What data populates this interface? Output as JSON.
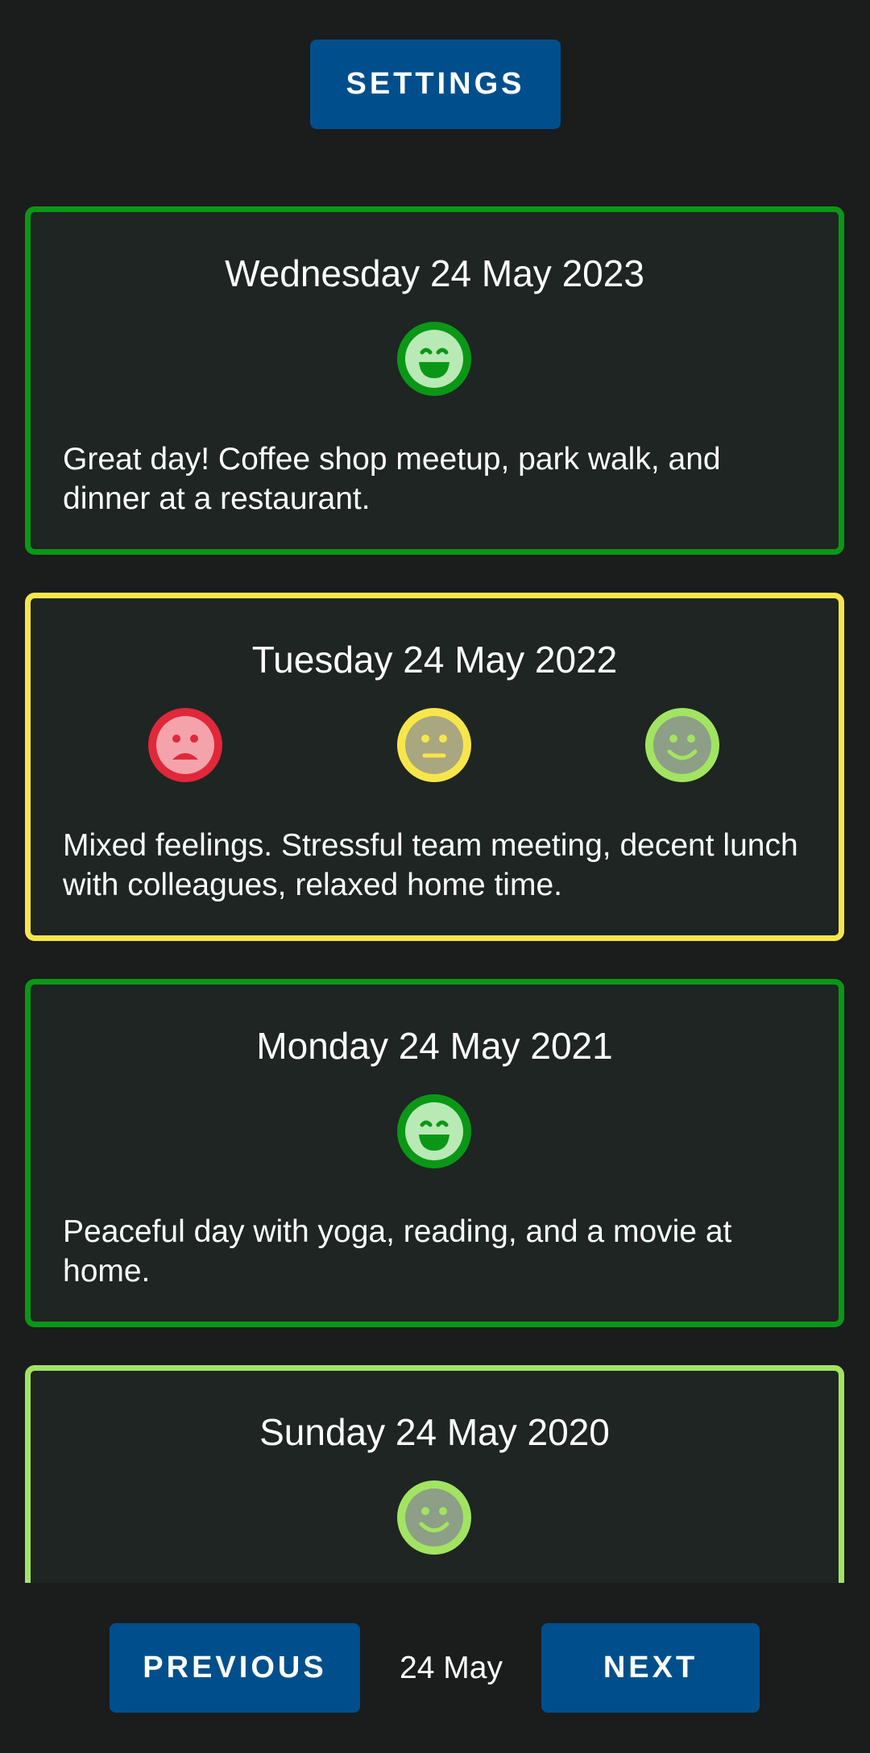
{
  "header": {
    "settings_label": "SETTINGS"
  },
  "entries": [
    {
      "date": "Wednesday 24 May 2023",
      "border_color": "#0b9716",
      "moods": [
        "very-happy"
      ],
      "note": "Great day! Coffee shop meetup, park walk, and dinner at a restaurant."
    },
    {
      "date": "Tuesday 24 May 2022",
      "border_color": "#f7e64a",
      "moods": [
        "sad",
        "neutral",
        "happy"
      ],
      "note": "Mixed feelings. Stressful team meeting, decent lunch with colleagues, relaxed home time."
    },
    {
      "date": "Monday 24 May 2021",
      "border_color": "#0b9716",
      "moods": [
        "very-happy"
      ],
      "note": "Peaceful day with yoga, reading, and a movie at home."
    },
    {
      "date": "Sunday 24 May 2020",
      "border_color": "#a2e462",
      "moods": [
        "happy"
      ],
      "note": ""
    }
  ],
  "mood_colors": {
    "very-happy": {
      "fill": "#0b9716",
      "face": "#b9e9b5"
    },
    "happy": {
      "fill": "#a2e462",
      "face": "#8d9f86"
    },
    "neutral": {
      "fill": "#f7e64a",
      "face": "#a9a77f"
    },
    "sad": {
      "fill": "#e0283a",
      "face": "#f4a3aa"
    }
  },
  "footer": {
    "previous_label": "PREVIOUS",
    "current_date": "24 May",
    "next_label": "NEXT"
  }
}
